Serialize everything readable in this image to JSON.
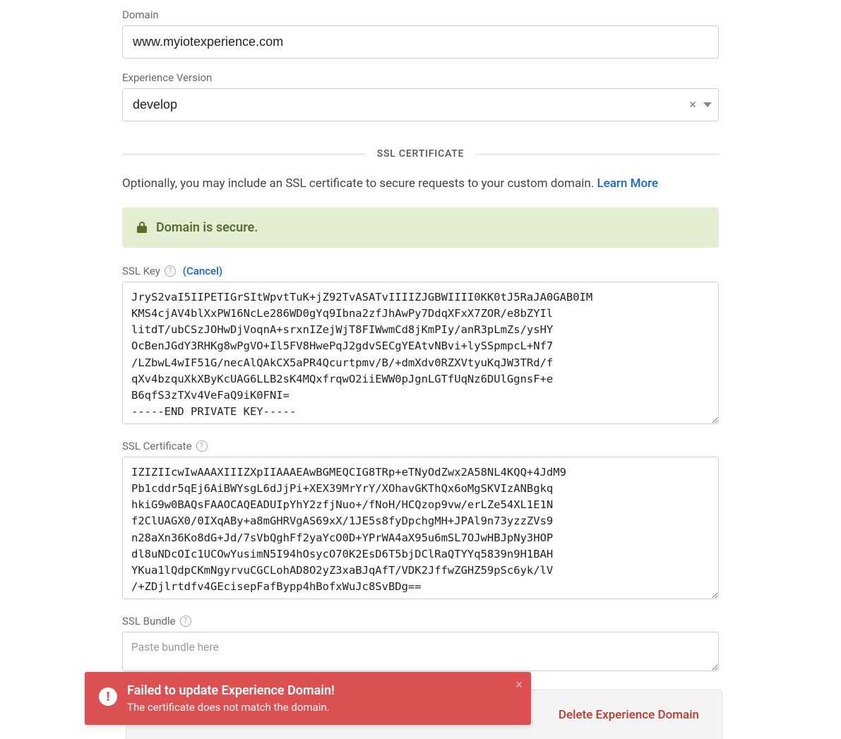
{
  "domain_field": {
    "label": "Domain",
    "value": "www.myiotexperience.com"
  },
  "version_field": {
    "label": "Experience Version",
    "value": "develop"
  },
  "ssl_section": {
    "title": "SSL CERTIFICATE",
    "intro_text": "Optionally, you may include an SSL certificate to secure requests to your custom domain. ",
    "learn_more": "Learn More",
    "secure_banner": "Domain is secure."
  },
  "ssl_key": {
    "label": "SSL Key",
    "cancel": "(Cancel)",
    "value": "JryS2vaI5IIPETIGrSItWpvtTuK+jZ92TvASATvIIIIZJGBWIIII0KK0tJ5RaJA0GAB0IM\nKMS4cjAV4blXxPW16NcLe286WD0gYq9Ibna2zfJhAwPy7DdqXFxX7ZOR/e8bZYIl\nlitdT/ubCSzJOHwDjVoqnA+srxnIZejWjT8FIWwmCd8jKmPIy/anR3pLmZs/ysHY\nOcBenJGdY3RHKg8wPgVO+Il5FV8HwePqJ2gdvSECgYEAtvNBvi+lySSpmpcL+Nf7\n/LZbwL4wIF51G/necAlQAkCX5aPR4Qcurtpmv/B/+dmXdv0RZXVtyuKqJW3TRd/f\nqXv4bzquXkXByKcUAG6LLB2sK4MQxfrqwO2iiEWW0pJgnLGTfUqNz6DUlGgnsF+e\nB6qfS3zTXv4VeFaQ9iK0FNI=\n-----END PRIVATE KEY-----"
  },
  "ssl_cert": {
    "label": "SSL Certificate",
    "value": "IZIZIIcwIwAAAXIIIZXpIIAAAEAwBGMEQCIG8TRp+eTNyOdZwx2A58NL4KQQ+4JdM9\nPb1cddr5qEj6AiBWYsgL6dJjPi+XEX39MrYrY/XOhavGKThQx6oMgSKVIzANBgkq\nhkiG9w0BAQsFAAOCAQEADUIpYhY2zfjNuo+/fNoH/HCQzop9vw/erLZe54XL1E1N\nf2ClUAGX0/0IXqABy+a8mGHRVgAS69xX/1JE5s8fyDpchgMH+JPAl9n73yzzZVs9\nn28aXn36Ko8dG+Jd/7sVbQghFf2yaYcO0D+YPrWA4aX95u6mSL7OJwHBJpNy3HOP\ndl8uNDcOIc1UCOwYusimN5I94hOsycO70K2EsD6T5bjDClRaQTYYq5839n9H1BAH\nYKua1lQdpCKmNgyrvuCGCLohAD8O2yZ3xaBJqAfT/VDK2JffwZGHZ59pSc6yk/lV\n/+ZDjlrtdfv4GEcisepFafBypp4hBofxWuJc8SvBDg==\n-----END CERTIFICATE-----"
  },
  "ssl_bundle": {
    "label": "SSL Bundle",
    "placeholder": "Paste bundle here"
  },
  "footer": {
    "delete": "Delete Experience Domain"
  },
  "toast": {
    "title": "Failed to update Experience Domain!",
    "message": "The certificate does not match the domain."
  }
}
